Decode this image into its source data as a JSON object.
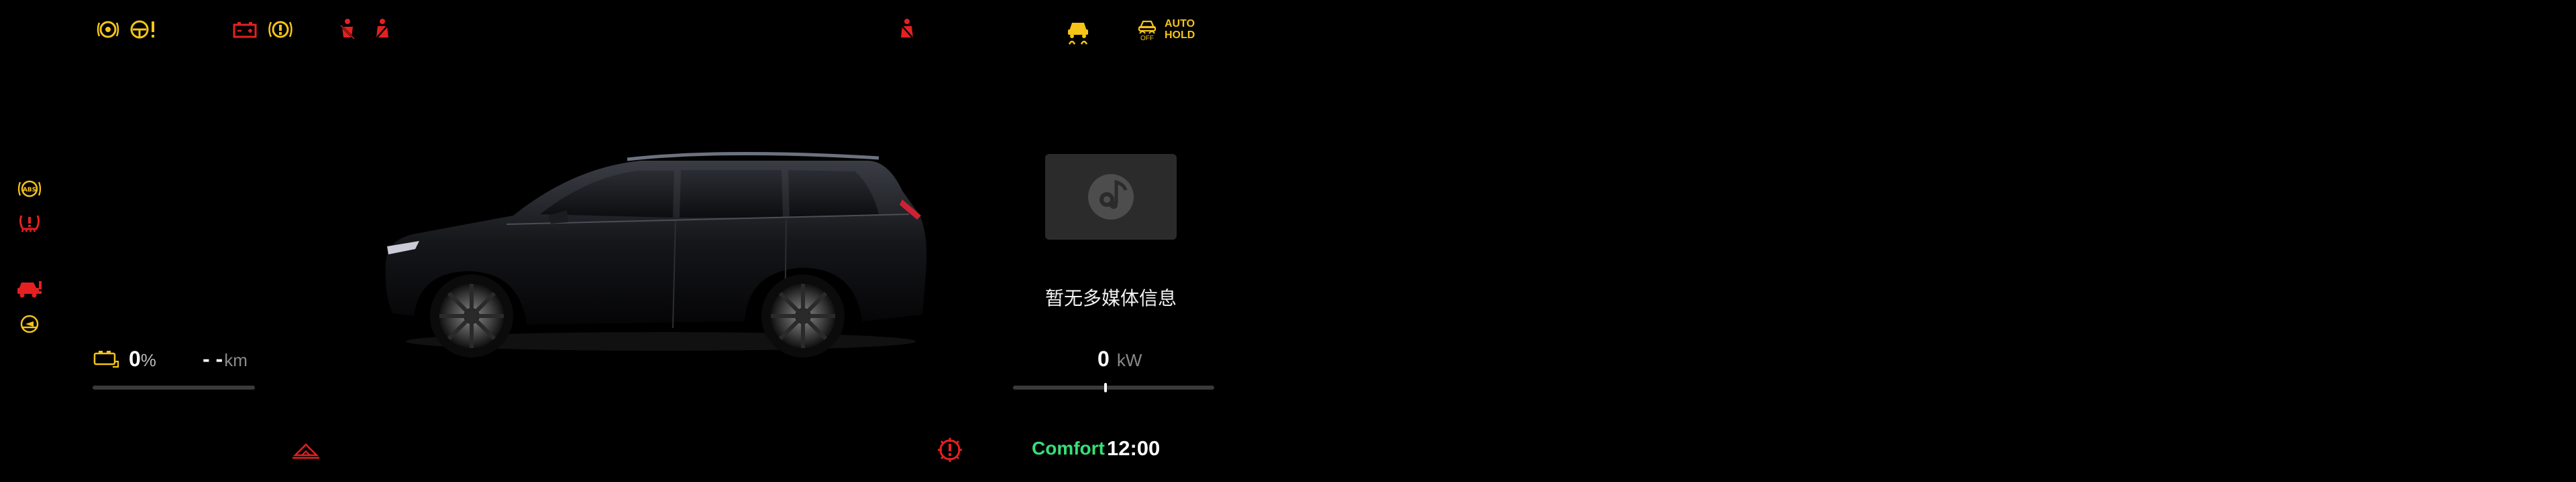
{
  "colors": {
    "yellow": "#f5c518",
    "red": "#e52020",
    "white": "#ffffff",
    "green": "#34e07a",
    "grey": "#8a8a8a"
  },
  "top_telltales": {
    "left": [
      "adas-steering-warning-icon",
      "power-steering-warning-icon",
      "battery-warning-icon",
      "brake-warning-icon",
      "seatbelt-driver-icon",
      "seatbelt-passenger-icon"
    ],
    "right": [
      "seatbelt-rear-icon",
      "traction-control-icon",
      "traction-off-icon"
    ]
  },
  "traction_off_label": "OFF",
  "auto_hold": {
    "line1": "AUTO",
    "line2": "HOLD"
  },
  "left_telltales": [
    "abs-icon",
    "tire-pressure-warning-icon",
    "vehicle-fault-icon",
    "low-beam-icon"
  ],
  "battery": {
    "percent": "0",
    "percent_unit": "%",
    "range": "- -",
    "range_unit": "km",
    "level_fraction": 0.0
  },
  "media": {
    "empty_text": "暂无多媒体信息"
  },
  "power": {
    "value": "0",
    "unit": "kW"
  },
  "status": {
    "drive_mode": "Comfort",
    "clock": "12:00"
  }
}
